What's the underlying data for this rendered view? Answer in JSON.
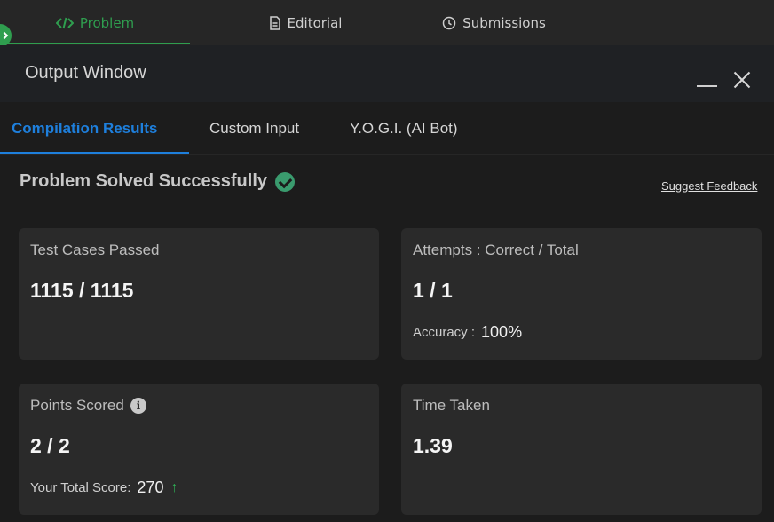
{
  "top_tabs": [
    {
      "label": "Problem",
      "icon": "code-icon",
      "active": true
    },
    {
      "label": "Editorial",
      "icon": "document-icon",
      "active": false
    },
    {
      "label": "Submissions",
      "icon": "clock-icon",
      "active": false
    }
  ],
  "window": {
    "title": "Output Window"
  },
  "result_tabs": [
    {
      "label": "Compilation Results",
      "active": true
    },
    {
      "label": "Custom Input",
      "active": false
    },
    {
      "label": "Y.O.G.I. (AI Bot)",
      "active": false
    }
  ],
  "status": {
    "message": "Problem Solved Successfully",
    "feedback_link": "Suggest Feedback"
  },
  "cards": {
    "test_cases": {
      "label": "Test Cases Passed",
      "value": "1115 / 1115"
    },
    "attempts": {
      "label": "Attempts : Correct / Total",
      "value": "1 / 1",
      "sub_label": "Accuracy :",
      "sub_value": "100%"
    },
    "points": {
      "label": "Points Scored",
      "value": "2 / 2",
      "sub_label": "Your Total Score:",
      "sub_value": "270"
    },
    "time": {
      "label": "Time Taken",
      "value": "1.39"
    }
  },
  "colors": {
    "accent_green": "#2f9e4f",
    "accent_blue": "#1e7fdc",
    "success_check": "#3a9b6e"
  }
}
